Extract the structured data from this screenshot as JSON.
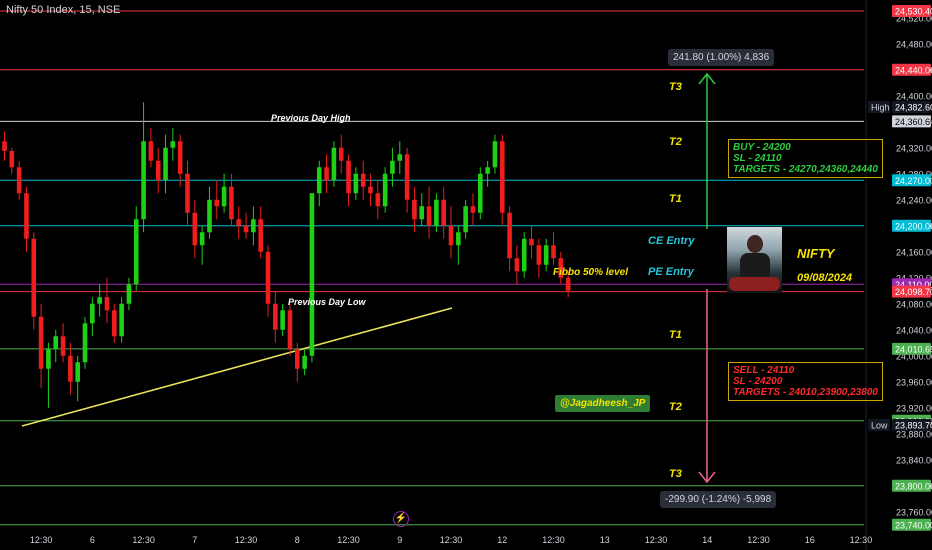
{
  "title": "Nifty 50 Index, 15, NSE",
  "colors": {
    "bull": "#1ed016",
    "bear": "#ef1d1d",
    "trend": "#e8e35a",
    "axisText": "#d1d4dc"
  },
  "chart_data": {
    "type": "candlestick",
    "ylim": [
      23735,
      24535
    ],
    "y_ticks": [
      23760,
      23800,
      23840,
      23880,
      23920,
      23960,
      24000,
      24040,
      24080,
      24120,
      24160,
      24200,
      24240,
      24280,
      24320,
      24360,
      24400,
      24440,
      24480,
      24520
    ],
    "x_ticks": [
      {
        "i": 5,
        "label": "12:30"
      },
      {
        "i": 12,
        "label": "6"
      },
      {
        "i": 19,
        "label": "12:30"
      },
      {
        "i": 26,
        "label": "7"
      },
      {
        "i": 33,
        "label": "12:30"
      },
      {
        "i": 40,
        "label": "8"
      },
      {
        "i": 47,
        "label": "12:30"
      },
      {
        "i": 54,
        "label": "9"
      },
      {
        "i": 61,
        "label": "12:30"
      },
      {
        "i": 68,
        "label": "12"
      },
      {
        "i": 75,
        "label": "12:30"
      },
      {
        "i": 82,
        "label": "13"
      },
      {
        "i": 89,
        "label": "12:30"
      },
      {
        "i": 96,
        "label": "14"
      },
      {
        "i": 103,
        "label": "12:30"
      },
      {
        "i": 110,
        "label": "16"
      },
      {
        "i": 117,
        "label": "12:30"
      }
    ],
    "candles": [
      [
        24330,
        24345,
        24300,
        24315
      ],
      [
        24315,
        24320,
        24280,
        24290
      ],
      [
        24290,
        24300,
        24240,
        24250
      ],
      [
        24250,
        24260,
        24160,
        24180
      ],
      [
        24180,
        24190,
        24040,
        24060
      ],
      [
        24060,
        24080,
        23950,
        23980
      ],
      [
        23980,
        24020,
        23920,
        24010
      ],
      [
        24010,
        24040,
        23990,
        24030
      ],
      [
        24030,
        24050,
        23990,
        24000
      ],
      [
        24000,
        24020,
        23940,
        23960
      ],
      [
        23960,
        24000,
        23930,
        23990
      ],
      [
        23990,
        24060,
        23980,
        24050
      ],
      [
        24050,
        24090,
        24030,
        24080
      ],
      [
        24080,
        24110,
        24060,
        24090
      ],
      [
        24090,
        24120,
        24050,
        24070
      ],
      [
        24070,
        24080,
        24020,
        24030
      ],
      [
        24030,
        24090,
        24020,
        24080
      ],
      [
        24080,
        24120,
        24070,
        24110
      ],
      [
        24110,
        24230,
        24100,
        24210
      ],
      [
        24210,
        24390,
        24190,
        24330
      ],
      [
        24330,
        24350,
        24290,
        24300
      ],
      [
        24300,
        24320,
        24250,
        24270
      ],
      [
        24270,
        24340,
        24250,
        24320
      ],
      [
        24320,
        24350,
        24300,
        24330
      ],
      [
        24330,
        24340,
        24260,
        24280
      ],
      [
        24280,
        24300,
        24200,
        24220
      ],
      [
        24220,
        24240,
        24150,
        24170
      ],
      [
        24170,
        24200,
        24140,
        24190
      ],
      [
        24190,
        24260,
        24180,
        24240
      ],
      [
        24240,
        24270,
        24210,
        24230
      ],
      [
        24230,
        24280,
        24220,
        24260
      ],
      [
        24260,
        24280,
        24200,
        24210
      ],
      [
        24210,
        24230,
        24180,
        24200
      ],
      [
        24200,
        24220,
        24180,
        24190
      ],
      [
        24190,
        24230,
        24170,
        24210
      ],
      [
        24210,
        24230,
        24150,
        24160
      ],
      [
        24160,
        24170,
        24060,
        24080
      ],
      [
        24080,
        24100,
        24020,
        24040
      ],
      [
        24040,
        24080,
        24030,
        24070
      ],
      [
        24070,
        24080,
        24000,
        24010
      ],
      [
        24010,
        24020,
        23960,
        23980
      ],
      [
        23980,
        24010,
        23970,
        24000
      ],
      [
        24000,
        24200,
        23990,
        24250
      ],
      [
        24250,
        24300,
        24230,
        24290
      ],
      [
        24290,
        24310,
        24250,
        24270
      ],
      [
        24270,
        24330,
        24260,
        24320
      ],
      [
        24320,
        24340,
        24280,
        24300
      ],
      [
        24300,
        24310,
        24230,
        24250
      ],
      [
        24250,
        24290,
        24240,
        24280
      ],
      [
        24280,
        24300,
        24240,
        24260
      ],
      [
        24260,
        24280,
        24230,
        24250
      ],
      [
        24250,
        24270,
        24210,
        24230
      ],
      [
        24230,
        24290,
        24220,
        24280
      ],
      [
        24280,
        24320,
        24260,
        24300
      ],
      [
        24300,
        24330,
        24280,
        24310
      ],
      [
        24310,
        24320,
        24220,
        24240
      ],
      [
        24240,
        24260,
        24190,
        24210
      ],
      [
        24210,
        24250,
        24200,
        24230
      ],
      [
        24230,
        24260,
        24180,
        24200
      ],
      [
        24200,
        24250,
        24190,
        24240
      ],
      [
        24240,
        24260,
        24180,
        24200
      ],
      [
        24200,
        24230,
        24150,
        24170
      ],
      [
        24170,
        24200,
        24140,
        24190
      ],
      [
        24190,
        24240,
        24180,
        24230
      ],
      [
        24230,
        24250,
        24200,
        24220
      ],
      [
        24220,
        24290,
        24210,
        24280
      ],
      [
        24280,
        24300,
        24260,
        24290
      ],
      [
        24290,
        24340,
        24280,
        24330
      ],
      [
        24330,
        24340,
        24200,
        24220
      ],
      [
        24220,
        24230,
        24130,
        24150
      ],
      [
        24150,
        24170,
        24110,
        24130
      ],
      [
        24130,
        24190,
        24120,
        24180
      ],
      [
        24180,
        24200,
        24150,
        24170
      ],
      [
        24170,
        24180,
        24120,
        24140
      ],
      [
        24140,
        24180,
        24130,
        24170
      ],
      [
        24170,
        24190,
        24140,
        24150
      ],
      [
        24150,
        24160,
        24110,
        24120
      ],
      [
        24120,
        24130,
        24090,
        24100
      ]
    ]
  },
  "levels": [
    {
      "price": 24530.4,
      "label": "24,530.40",
      "color": "#f23645"
    },
    {
      "price": 24440.0,
      "label": "24,440.00",
      "color": "#f23645"
    },
    {
      "price": 24382.6,
      "label": "24,382.60",
      "color": "#131722",
      "side": "High"
    },
    {
      "price": 24360.65,
      "label": "24,360.65",
      "color": "#d1d4dc"
    },
    {
      "price": 24270.0,
      "label": "24,270.00",
      "color": "#00bcd4"
    },
    {
      "price": 24200.0,
      "label": "24,200.00",
      "color": "#00bcd4"
    },
    {
      "price": 24110.0,
      "label": "24,110.00",
      "color": "#9c27b0"
    },
    {
      "price": 24098.7,
      "label": "24,098.70",
      "color": "#f23645"
    },
    {
      "price": 24010.65,
      "label": "24,010.65",
      "color": "#4caf50"
    },
    {
      "price": 23900.0,
      "label": "23,900.00",
      "color": "#4caf50"
    },
    {
      "price": 23893.7,
      "label": "23,893.70",
      "color": "#131722",
      "side": "Low"
    },
    {
      "price": 23800.0,
      "label": "23,800.00",
      "color": "#4caf50"
    },
    {
      "price": 23740.0,
      "label": "23,740.00",
      "color": "#4caf50"
    }
  ],
  "annotations": {
    "prev_high": "Previous Day High",
    "prev_low": "Previous Day Low",
    "fibbo": "Fibbo 50% level",
    "ce_entry": "CE Entry",
    "pe_entry": "PE Entry",
    "t3_up": "T3",
    "t2_up": "T2",
    "t1_up": "T1",
    "t1_dn": "T1",
    "t2_dn": "T2",
    "t3_dn": "T3"
  },
  "measure_up": "241.80 (1.00%) 4,836",
  "measure_down": "-299.90 (-1.24%) -5,998",
  "buy_box": {
    "line1": "BUY - 24200",
    "line2": "SL - 24110",
    "line3": "TARGETS - 24270,24360,24440"
  },
  "sell_box": {
    "line1": "SELL - 24110",
    "line2": "SL - 24200",
    "line3": "TARGETS - 24010,23900,23800"
  },
  "watermark": "@Jagadheesh_JP",
  "brand": {
    "name": "NIFTY",
    "date": "09/08/2024"
  },
  "zap_icon": "lightning-icon"
}
